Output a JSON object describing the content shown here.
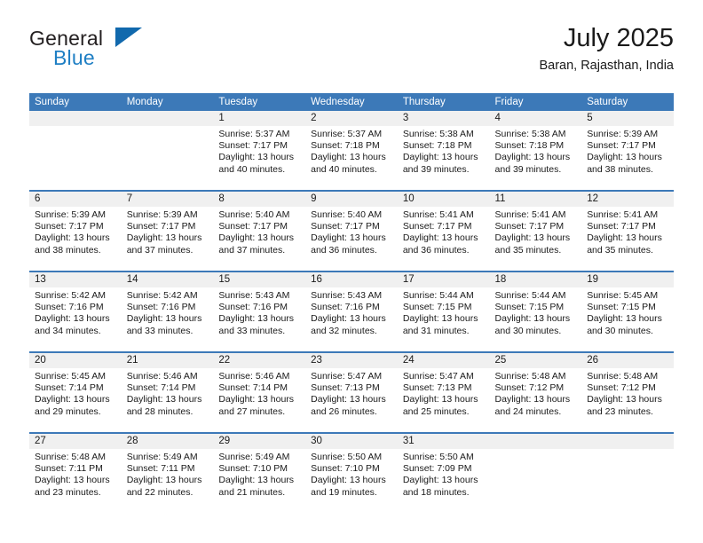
{
  "brand": {
    "word_general": "General",
    "word_blue": "Blue",
    "logo_icon": "triangle-logo-icon"
  },
  "header": {
    "title": "July 2025",
    "subtitle": "Baran, Rajasthan, India"
  },
  "colors": {
    "accent_blue": "#3c79b8",
    "brand_blue": "#1f7fc4",
    "logo_blue": "#1169ad",
    "daynum_band": "#f0f0f0",
    "text": "#1a1a1a",
    "header_text": "#ffffff"
  },
  "calendar": {
    "day_headers": [
      "Sunday",
      "Monday",
      "Tuesday",
      "Wednesday",
      "Thursday",
      "Friday",
      "Saturday"
    ],
    "weeks": [
      [
        {
          "day": "",
          "lines": []
        },
        {
          "day": "",
          "lines": []
        },
        {
          "day": "1",
          "lines": [
            "Sunrise: 5:37 AM",
            "Sunset: 7:17 PM",
            "Daylight: 13 hours",
            "and 40 minutes."
          ]
        },
        {
          "day": "2",
          "lines": [
            "Sunrise: 5:37 AM",
            "Sunset: 7:18 PM",
            "Daylight: 13 hours",
            "and 40 minutes."
          ]
        },
        {
          "day": "3",
          "lines": [
            "Sunrise: 5:38 AM",
            "Sunset: 7:18 PM",
            "Daylight: 13 hours",
            "and 39 minutes."
          ]
        },
        {
          "day": "4",
          "lines": [
            "Sunrise: 5:38 AM",
            "Sunset: 7:18 PM",
            "Daylight: 13 hours",
            "and 39 minutes."
          ]
        },
        {
          "day": "5",
          "lines": [
            "Sunrise: 5:39 AM",
            "Sunset: 7:17 PM",
            "Daylight: 13 hours",
            "and 38 minutes."
          ]
        }
      ],
      [
        {
          "day": "6",
          "lines": [
            "Sunrise: 5:39 AM",
            "Sunset: 7:17 PM",
            "Daylight: 13 hours",
            "and 38 minutes."
          ]
        },
        {
          "day": "7",
          "lines": [
            "Sunrise: 5:39 AM",
            "Sunset: 7:17 PM",
            "Daylight: 13 hours",
            "and 37 minutes."
          ]
        },
        {
          "day": "8",
          "lines": [
            "Sunrise: 5:40 AM",
            "Sunset: 7:17 PM",
            "Daylight: 13 hours",
            "and 37 minutes."
          ]
        },
        {
          "day": "9",
          "lines": [
            "Sunrise: 5:40 AM",
            "Sunset: 7:17 PM",
            "Daylight: 13 hours",
            "and 36 minutes."
          ]
        },
        {
          "day": "10",
          "lines": [
            "Sunrise: 5:41 AM",
            "Sunset: 7:17 PM",
            "Daylight: 13 hours",
            "and 36 minutes."
          ]
        },
        {
          "day": "11",
          "lines": [
            "Sunrise: 5:41 AM",
            "Sunset: 7:17 PM",
            "Daylight: 13 hours",
            "and 35 minutes."
          ]
        },
        {
          "day": "12",
          "lines": [
            "Sunrise: 5:41 AM",
            "Sunset: 7:17 PM",
            "Daylight: 13 hours",
            "and 35 minutes."
          ]
        }
      ],
      [
        {
          "day": "13",
          "lines": [
            "Sunrise: 5:42 AM",
            "Sunset: 7:16 PM",
            "Daylight: 13 hours",
            "and 34 minutes."
          ]
        },
        {
          "day": "14",
          "lines": [
            "Sunrise: 5:42 AM",
            "Sunset: 7:16 PM",
            "Daylight: 13 hours",
            "and 33 minutes."
          ]
        },
        {
          "day": "15",
          "lines": [
            "Sunrise: 5:43 AM",
            "Sunset: 7:16 PM",
            "Daylight: 13 hours",
            "and 33 minutes."
          ]
        },
        {
          "day": "16",
          "lines": [
            "Sunrise: 5:43 AM",
            "Sunset: 7:16 PM",
            "Daylight: 13 hours",
            "and 32 minutes."
          ]
        },
        {
          "day": "17",
          "lines": [
            "Sunrise: 5:44 AM",
            "Sunset: 7:15 PM",
            "Daylight: 13 hours",
            "and 31 minutes."
          ]
        },
        {
          "day": "18",
          "lines": [
            "Sunrise: 5:44 AM",
            "Sunset: 7:15 PM",
            "Daylight: 13 hours",
            "and 30 minutes."
          ]
        },
        {
          "day": "19",
          "lines": [
            "Sunrise: 5:45 AM",
            "Sunset: 7:15 PM",
            "Daylight: 13 hours",
            "and 30 minutes."
          ]
        }
      ],
      [
        {
          "day": "20",
          "lines": [
            "Sunrise: 5:45 AM",
            "Sunset: 7:14 PM",
            "Daylight: 13 hours",
            "and 29 minutes."
          ]
        },
        {
          "day": "21",
          "lines": [
            "Sunrise: 5:46 AM",
            "Sunset: 7:14 PM",
            "Daylight: 13 hours",
            "and 28 minutes."
          ]
        },
        {
          "day": "22",
          "lines": [
            "Sunrise: 5:46 AM",
            "Sunset: 7:14 PM",
            "Daylight: 13 hours",
            "and 27 minutes."
          ]
        },
        {
          "day": "23",
          "lines": [
            "Sunrise: 5:47 AM",
            "Sunset: 7:13 PM",
            "Daylight: 13 hours",
            "and 26 minutes."
          ]
        },
        {
          "day": "24",
          "lines": [
            "Sunrise: 5:47 AM",
            "Sunset: 7:13 PM",
            "Daylight: 13 hours",
            "and 25 minutes."
          ]
        },
        {
          "day": "25",
          "lines": [
            "Sunrise: 5:48 AM",
            "Sunset: 7:12 PM",
            "Daylight: 13 hours",
            "and 24 minutes."
          ]
        },
        {
          "day": "26",
          "lines": [
            "Sunrise: 5:48 AM",
            "Sunset: 7:12 PM",
            "Daylight: 13 hours",
            "and 23 minutes."
          ]
        }
      ],
      [
        {
          "day": "27",
          "lines": [
            "Sunrise: 5:48 AM",
            "Sunset: 7:11 PM",
            "Daylight: 13 hours",
            "and 23 minutes."
          ]
        },
        {
          "day": "28",
          "lines": [
            "Sunrise: 5:49 AM",
            "Sunset: 7:11 PM",
            "Daylight: 13 hours",
            "and 22 minutes."
          ]
        },
        {
          "day": "29",
          "lines": [
            "Sunrise: 5:49 AM",
            "Sunset: 7:10 PM",
            "Daylight: 13 hours",
            "and 21 minutes."
          ]
        },
        {
          "day": "30",
          "lines": [
            "Sunrise: 5:50 AM",
            "Sunset: 7:10 PM",
            "Daylight: 13 hours",
            "and 19 minutes."
          ]
        },
        {
          "day": "31",
          "lines": [
            "Sunrise: 5:50 AM",
            "Sunset: 7:09 PM",
            "Daylight: 13 hours",
            "and 18 minutes."
          ]
        },
        {
          "day": "",
          "lines": []
        },
        {
          "day": "",
          "lines": []
        }
      ]
    ]
  }
}
